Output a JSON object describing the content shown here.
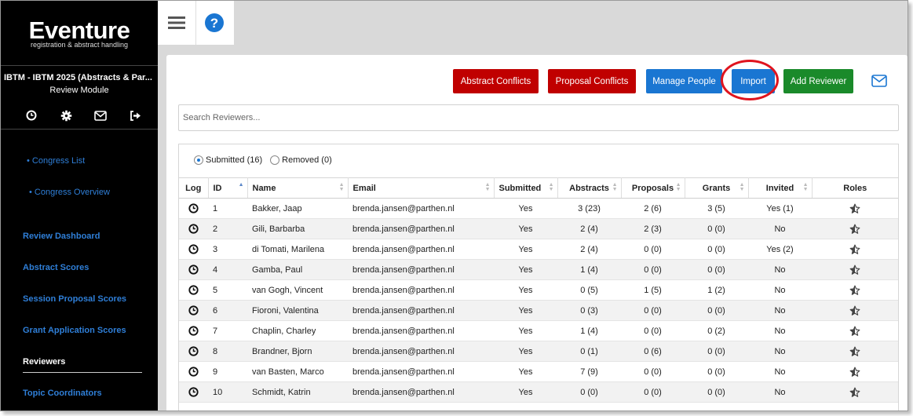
{
  "brand": {
    "name": "Eventure",
    "tagline": "registration & abstract handling"
  },
  "event": {
    "title": "IBTM - IBTM 2025 (Abstracts & Par...",
    "module": "Review Module"
  },
  "sidebar_icons": [
    "clock-icon",
    "gear-icon",
    "mail-icon",
    "logout-icon"
  ],
  "nav": {
    "congress_list": "• Congress List",
    "congress_overview": "• Congress Overview",
    "review_dashboard": "Review Dashboard",
    "abstract_scores": "Abstract Scores",
    "session_proposal_scores": "Session Proposal Scores",
    "grant_application_scores": "Grant Application Scores",
    "reviewers": "Reviewers",
    "topic_coordinators": "Topic Coordinators"
  },
  "toolbar": {
    "abstract_conflicts": "Abstract Conflicts",
    "proposal_conflicts": "Proposal Conflicts",
    "manage_people": "Manage People",
    "import": "Import",
    "add_reviewer": "Add Reviewer"
  },
  "search": {
    "placeholder": "Search Reviewers..."
  },
  "filters": {
    "submitted": "Submitted (16)",
    "removed": "Removed (0)"
  },
  "table": {
    "headers": {
      "log": "Log",
      "id": "ID",
      "name": "Name",
      "email": "Email",
      "submitted": "Submitted",
      "abstracts": "Abstracts",
      "proposals": "Proposals",
      "grants": "Grants",
      "invited": "Invited",
      "roles": "Roles"
    },
    "rows": [
      {
        "id": "1",
        "name": "Bakker, Jaap",
        "email": "brenda.jansen@parthen.nl",
        "submitted": "Yes",
        "abstracts": "3 (23)",
        "proposals": "2 (6)",
        "grants": "3 (5)",
        "invited": "Yes (1)"
      },
      {
        "id": "2",
        "name": "Gili, Barbarba",
        "email": "brenda.jansen@parthen.nl",
        "submitted": "Yes",
        "abstracts": "2 (4)",
        "proposals": "2 (3)",
        "grants": "0 (0)",
        "invited": "No"
      },
      {
        "id": "3",
        "name": "di Tomati, Marilena",
        "email": "brenda.jansen@parthen.nl",
        "submitted": "Yes",
        "abstracts": "2 (4)",
        "proposals": "0 (0)",
        "grants": "0 (0)",
        "invited": "Yes (2)"
      },
      {
        "id": "4",
        "name": "Gamba, Paul",
        "email": "brenda.jansen@parthen.nl",
        "submitted": "Yes",
        "abstracts": "1 (4)",
        "proposals": "0 (0)",
        "grants": "0 (0)",
        "invited": "No"
      },
      {
        "id": "5",
        "name": "van Gogh, Vincent",
        "email": "brenda.jansen@parthen.nl",
        "submitted": "Yes",
        "abstracts": "0 (5)",
        "proposals": "1 (5)",
        "grants": "1 (2)",
        "invited": "No"
      },
      {
        "id": "6",
        "name": "Fioroni, Valentina",
        "email": "brenda.jansen@parthen.nl",
        "submitted": "Yes",
        "abstracts": "0 (3)",
        "proposals": "0 (0)",
        "grants": "0 (0)",
        "invited": "No"
      },
      {
        "id": "7",
        "name": "Chaplin, Charley",
        "email": "brenda.jansen@parthen.nl",
        "submitted": "Yes",
        "abstracts": "1 (4)",
        "proposals": "0 (0)",
        "grants": "0 (2)",
        "invited": "No"
      },
      {
        "id": "8",
        "name": "Brandner, Bjorn",
        "email": "brenda.jansen@parthen.nl",
        "submitted": "Yes",
        "abstracts": "0 (1)",
        "proposals": "0 (6)",
        "grants": "0 (0)",
        "invited": "No"
      },
      {
        "id": "9",
        "name": "van Basten, Marco",
        "email": "brenda.jansen@parthen.nl",
        "submitted": "Yes",
        "abstracts": "7 (9)",
        "proposals": "0 (0)",
        "grants": "0 (0)",
        "invited": "No"
      },
      {
        "id": "10",
        "name": "Schmidt, Katrin",
        "email": "brenda.jansen@parthen.nl",
        "submitted": "Yes",
        "abstracts": "0 (0)",
        "proposals": "0 (0)",
        "grants": "0 (0)",
        "invited": "No"
      }
    ]
  },
  "colors": {
    "sidebar_bg": "#000000",
    "link": "#2f7fd8",
    "red": "#c00000",
    "blue": "#1a76d2",
    "green": "#1a8a2a",
    "annotation": "#e0141e"
  }
}
